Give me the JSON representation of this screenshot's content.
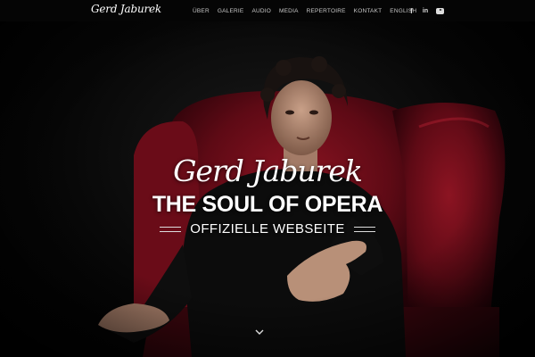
{
  "header": {
    "logo_text": "Gerd Jaburek",
    "nav": [
      "ÜBER",
      "GALERIE",
      "AUDIO",
      "MEDIA",
      "REPERTOIRE",
      "KONTAKT",
      "ENGLISH"
    ],
    "socials": [
      "facebook-icon",
      "linkedin-icon",
      "youtube-icon"
    ]
  },
  "hero": {
    "signature": "Gerd Jaburek",
    "headline": "THE SOUL OF OPERA",
    "subtitle": "OFFIZIELLE WEBSEITE",
    "scroll_icon": "chevron-down-icon"
  },
  "colors": {
    "background": "#000000",
    "armchair": "#7a0f1c",
    "text": "#ffffff"
  }
}
